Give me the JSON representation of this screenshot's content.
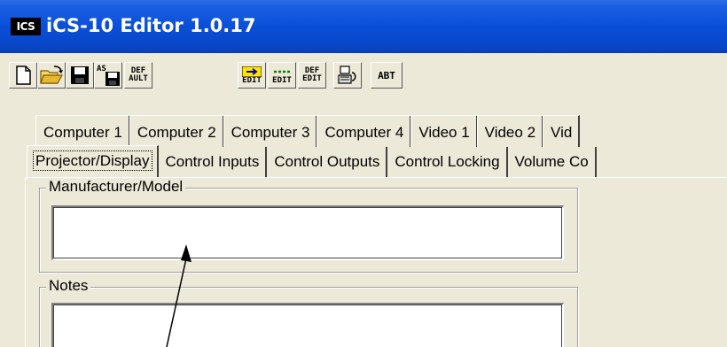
{
  "window": {
    "app_icon_text": "ICS",
    "title": "iCS-10 Editor 1.0.17"
  },
  "toolbar": {
    "buttons": [
      {
        "name": "new-document-icon"
      },
      {
        "name": "open-folder-icon"
      },
      {
        "name": "save-icon"
      },
      {
        "name": "save-as-icon",
        "label": "AS"
      },
      {
        "name": "default-button",
        "label_top": "DEF",
        "label_bottom": "AULT"
      },
      {
        "name": "edit-button-1",
        "label": "EDIT"
      },
      {
        "name": "edit-button-2",
        "label": "EDIT"
      },
      {
        "name": "def-edit-button",
        "label_top": "DEF",
        "label_bottom": "EDIT"
      },
      {
        "name": "device-icon"
      },
      {
        "name": "about-button",
        "label": "ABT"
      }
    ]
  },
  "tabs_row1": [
    "Computer 1",
    "Computer 2",
    "Computer 3",
    "Computer 4",
    "Video 1",
    "Video 2",
    "Vid"
  ],
  "tabs_row2": [
    "Projector/Display",
    "Control Inputs",
    "Control Outputs",
    "Control Locking",
    "Volume Co"
  ],
  "active_tab": "Projector/Display",
  "fields": {
    "manufacturer_model": {
      "label": "Manufacturer/Model",
      "value": ""
    },
    "notes": {
      "label": "Notes",
      "value": ""
    }
  },
  "colors": {
    "titlebar": "#0a4fd8",
    "window_bg": "#ece9d8"
  }
}
